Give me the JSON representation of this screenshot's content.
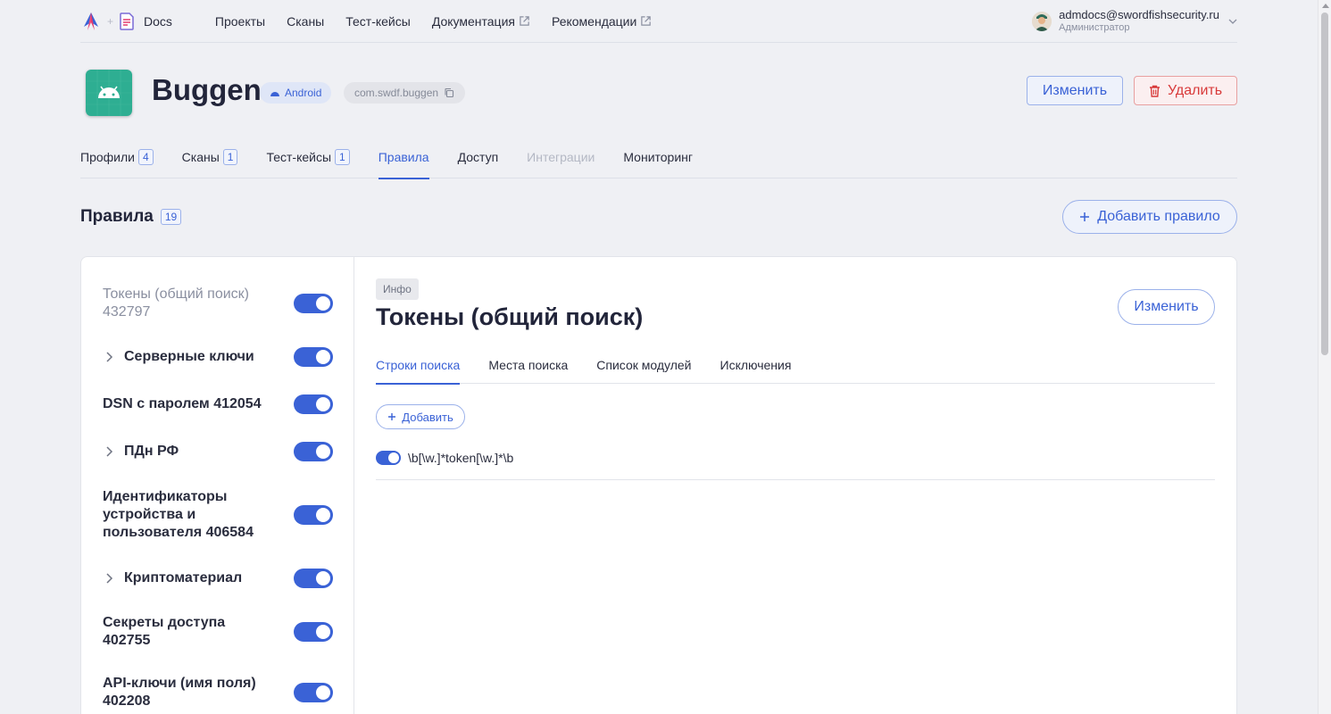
{
  "topnav": {
    "docs_label": "Docs",
    "links": [
      "Проекты",
      "Сканы",
      "Тест-кейсы",
      "Документация",
      "Рекомендации"
    ],
    "user_email": "admdocs@swordfishsecurity.ru",
    "user_role": "Администратор"
  },
  "app": {
    "title": "Buggen",
    "platform": "Android",
    "package": "com.swdf.buggen",
    "edit_label": "Изменить",
    "delete_label": "Удалить"
  },
  "tabs": {
    "profiles": "Профили",
    "profiles_count": "4",
    "scans": "Сканы",
    "scans_count": "1",
    "testcases": "Тест-кейсы",
    "testcases_count": "1",
    "rules": "Правила",
    "access": "Доступ",
    "integrations": "Интеграции",
    "monitoring": "Мониторинг"
  },
  "rules": {
    "title": "Правила",
    "count": "19",
    "add_label": "Добавить правило",
    "items": [
      "Токены (общий поиск) 432797",
      "Серверные ключи",
      "DSN с паролем 412054",
      "ПДн РФ",
      "Идентификаторы устройства и пользователя 406584",
      "Криптоматериал",
      "Секреты доступа 402755",
      "API-ключи (имя поля) 402208"
    ]
  },
  "detail": {
    "badge": "Инфо",
    "title": "Токены (общий поиск)",
    "edit_label": "Изменить",
    "subtabs": [
      "Строки поиска",
      "Места поиска",
      "Список модулей",
      "Исключения"
    ],
    "add_label": "Добавить",
    "pattern": "\\b[\\w.]*token[\\w.]*\\b"
  },
  "colors": {
    "accent": "#3a62d6",
    "danger": "#d83a3a",
    "app_icon": "#2eae92"
  }
}
